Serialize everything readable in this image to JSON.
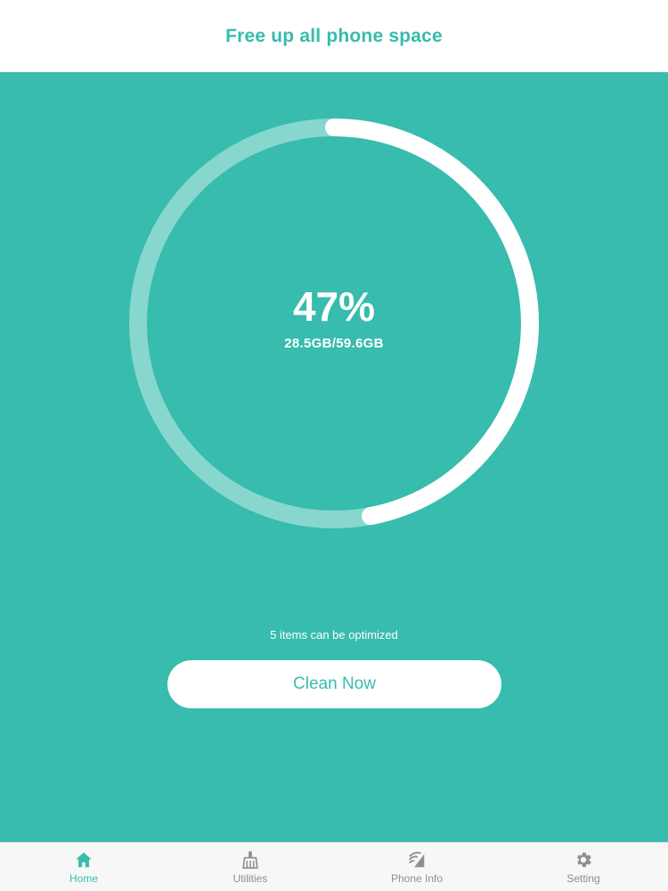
{
  "header": {
    "title": "Free up all phone space"
  },
  "storage": {
    "used_fraction": 0.47,
    "percent_label": "47%",
    "usage_label": "28.5GB/59.6GB"
  },
  "optimize": {
    "items_text": "5 items can be optimized",
    "button_label": "Clean Now"
  },
  "tabs": [
    {
      "label": "Home",
      "icon": "home-icon",
      "active": true
    },
    {
      "label": "Utilities",
      "icon": "broom-icon",
      "active": false
    },
    {
      "label": "Phone Info",
      "icon": "phone-signal-icon",
      "active": false
    },
    {
      "label": "Setting",
      "icon": "gear-icon",
      "active": false
    }
  ],
  "colors": {
    "accent": "#37bcad",
    "ring_track": "#87d7ce",
    "ring_fill": "#ffffff",
    "tab_inactive": "#8e8e93"
  }
}
